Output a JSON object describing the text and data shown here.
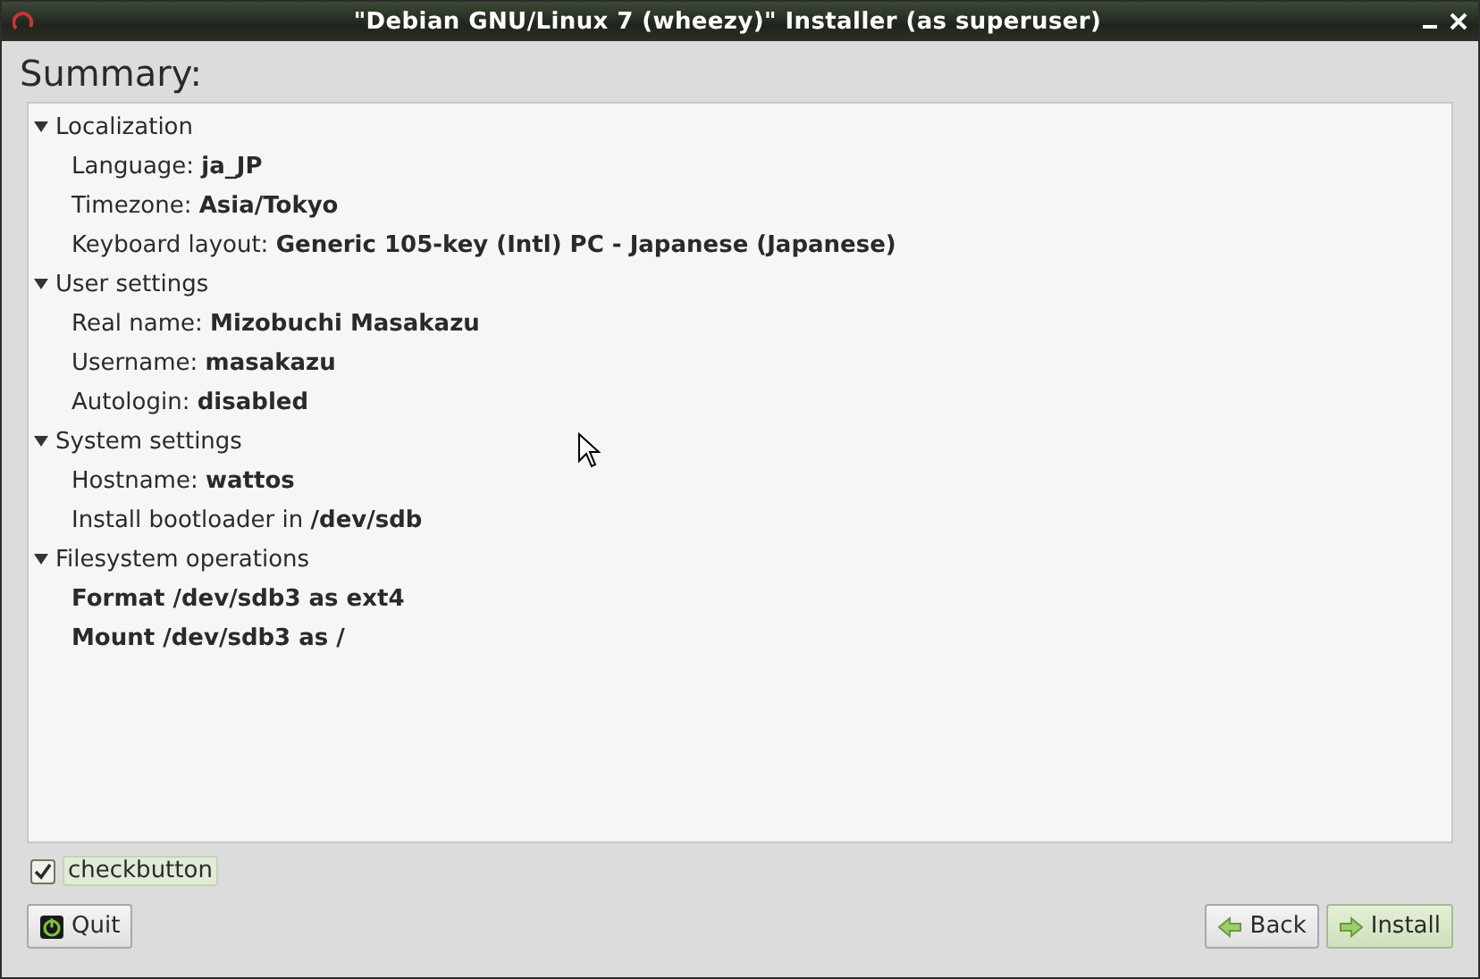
{
  "window": {
    "title": "\"Debian GNU/Linux 7 (wheezy)\" Installer (as superuser)"
  },
  "heading": "Summary:",
  "groups": [
    {
      "label": "Localization",
      "expanded": true,
      "items": [
        {
          "kind": "setting",
          "text": "Language: **ja_JP**"
        },
        {
          "kind": "setting",
          "text": "Timezone: **Asia/Tokyo**"
        },
        {
          "kind": "setting",
          "text": "Keyboard layout: **Generic 105-key (Intl) PC - Japanese (Japanese)**"
        }
      ]
    },
    {
      "label": "User settings",
      "expanded": true,
      "items": [
        {
          "kind": "setting",
          "text": "Real name: **Mizobuchi Masakazu**"
        },
        {
          "kind": "setting",
          "text": "Username: **masakazu**"
        },
        {
          "kind": "setting",
          "text": "Autologin: **disabled**"
        }
      ]
    },
    {
      "label": "System settings",
      "expanded": true,
      "items": [
        {
          "kind": "setting",
          "text": "Hostname: **wattos**"
        },
        {
          "kind": "setting",
          "text": "Install bootloader in **/dev/sdb**"
        }
      ]
    },
    {
      "label": "Filesystem operations",
      "expanded": true,
      "items": [
        {
          "kind": "operation",
          "text": "Format /dev/sdb3 as ext4"
        },
        {
          "kind": "operation",
          "text": "Mount /dev/sdb3 as /"
        }
      ]
    }
  ],
  "checkbox": {
    "label": "checkbutton",
    "checked": true
  },
  "buttons": [
    {
      "label": "Quit",
      "kind": "quit"
    },
    {
      "label": "Back",
      "kind": "back"
    },
    {
      "label": "Install",
      "kind": "install"
    }
  ]
}
